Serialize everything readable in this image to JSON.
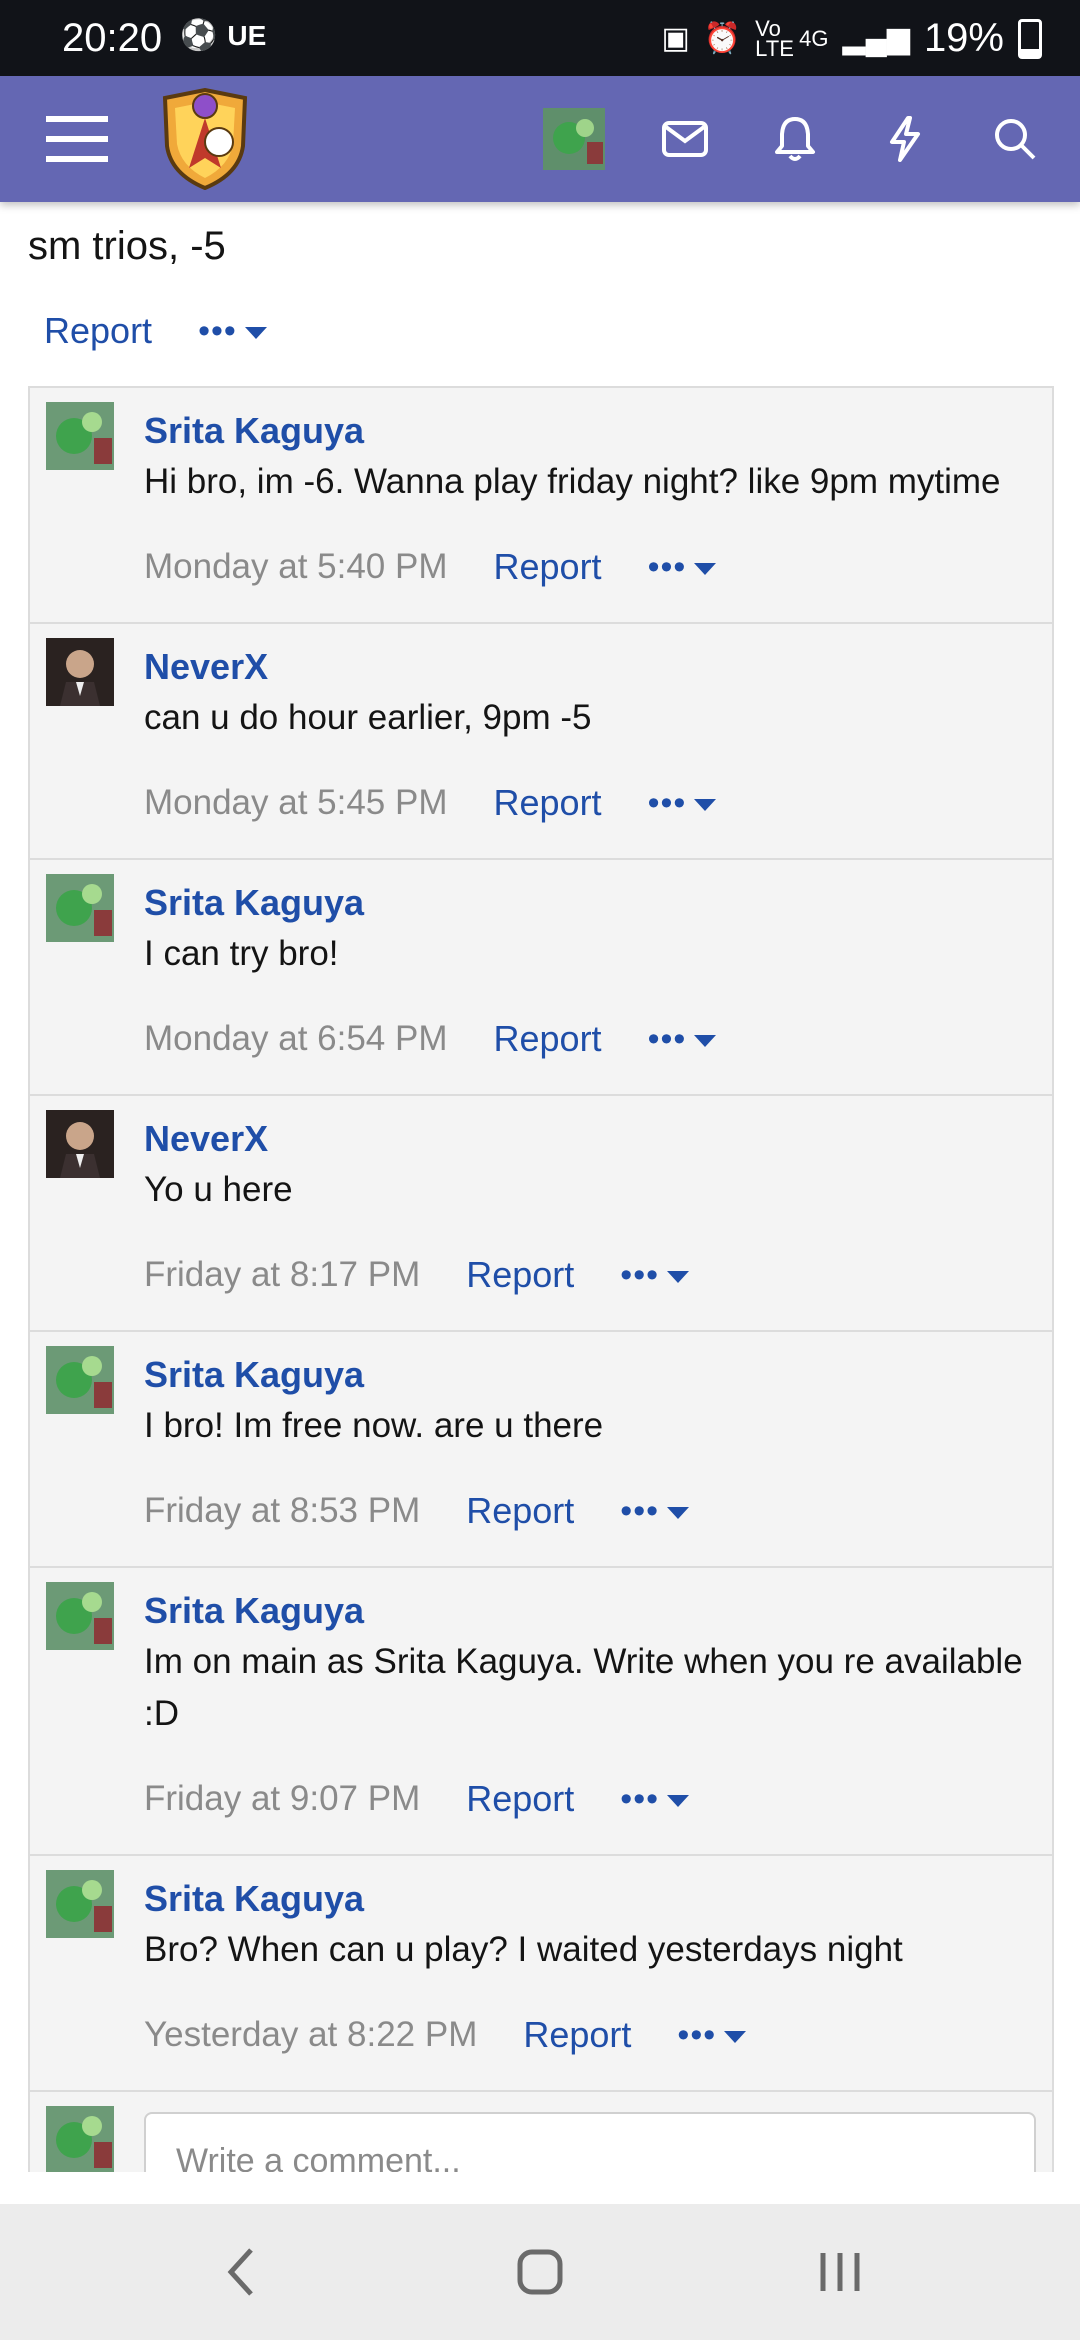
{
  "status_bar": {
    "time": "20:20",
    "carrier": "UE",
    "network": "4G",
    "lte": "Vo LTE",
    "battery": "19%"
  },
  "nav": {
    "icons": [
      "menu-icon",
      "site-logo",
      "user-avatar",
      "mail-icon",
      "bell-icon",
      "bolt-icon",
      "search-icon"
    ]
  },
  "top_post": {
    "text": "sm trios, -5",
    "report": "Report",
    "more": "•••"
  },
  "comments": [
    {
      "user": "Srita Kaguya",
      "text": "Hi bro, im -6. Wanna play friday night? like 9pm mytime",
      "time": "Monday at 5:40 PM",
      "report": "Report",
      "more": "•••",
      "avatar": "green"
    },
    {
      "user": "NeverX",
      "text": "can u do hour earlier, 9pm -5",
      "time": "Monday at 5:45 PM",
      "report": "Report",
      "more": "•••",
      "avatar": "suit"
    },
    {
      "user": "Srita Kaguya",
      "text": "I can try bro!",
      "time": "Monday at 6:54 PM",
      "report": "Report",
      "more": "•••",
      "avatar": "green"
    },
    {
      "user": "NeverX",
      "text": "Yo u here",
      "time": "Friday at 8:17 PM",
      "report": "Report",
      "more": "•••",
      "avatar": "suit"
    },
    {
      "user": "Srita Kaguya",
      "text": "I bro! Im free now. are u there",
      "time": "Friday at 8:53 PM",
      "report": "Report",
      "more": "•••",
      "avatar": "green"
    },
    {
      "user": "Srita Kaguya",
      "text": "Im on main as Srita Kaguya. Write when you re available :D",
      "time": "Friday at 9:07 PM",
      "report": "Report",
      "more": "•••",
      "avatar": "green"
    },
    {
      "user": "Srita Kaguya",
      "text": "Bro? When can u play? I waited yesterdays night",
      "time": "Yesterday at 8:22 PM",
      "report": "Report",
      "more": "•••",
      "avatar": "green"
    }
  ],
  "reply": {
    "placeholder": "Write a comment..."
  },
  "colors": {
    "navbar": "#6467b3",
    "link": "#1f4ea8",
    "muted": "#8a8a8a"
  }
}
